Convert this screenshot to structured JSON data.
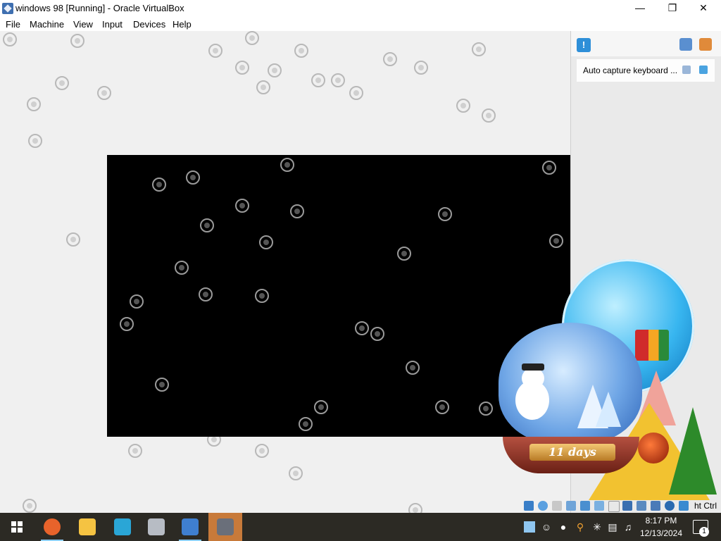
{
  "window": {
    "title": "windows 98 [Running] - Oracle VirtualBox",
    "minimize_glyph": "—",
    "restore_glyph": "❐",
    "close_glyph": "✕"
  },
  "menu": {
    "items": [
      "File",
      "Machine",
      "View",
      "Input",
      "Devices",
      "Help"
    ]
  },
  "notification_panel": {
    "icon_glyph": "!",
    "message": "Auto capture keyboard ..."
  },
  "desktop_widget": {
    "countdown_label": "11 days"
  },
  "status_bar": {
    "host_key_label": "ht Ctrl"
  },
  "taskbar": {
    "apps": [
      {
        "name": "Firefox",
        "color": "#e8632b"
      },
      {
        "name": "File Explorer",
        "color": "#f5c342"
      },
      {
        "name": "VirtualBox tool",
        "color": "#2aa6d6"
      },
      {
        "name": "Disk app",
        "color": "#b7bcc4"
      },
      {
        "name": "Windows 98",
        "color": "#3f7fd0"
      },
      {
        "name": "Oracle VirtualBox",
        "color": "#6a6f7a"
      }
    ],
    "clock_time": "8:17 PM",
    "clock_date": "12/13/2024",
    "notification_count": "1"
  },
  "colors": {
    "guest_screen": "#000000",
    "taskbar": "#2c2a24",
    "accent": "#2e8fd8"
  }
}
